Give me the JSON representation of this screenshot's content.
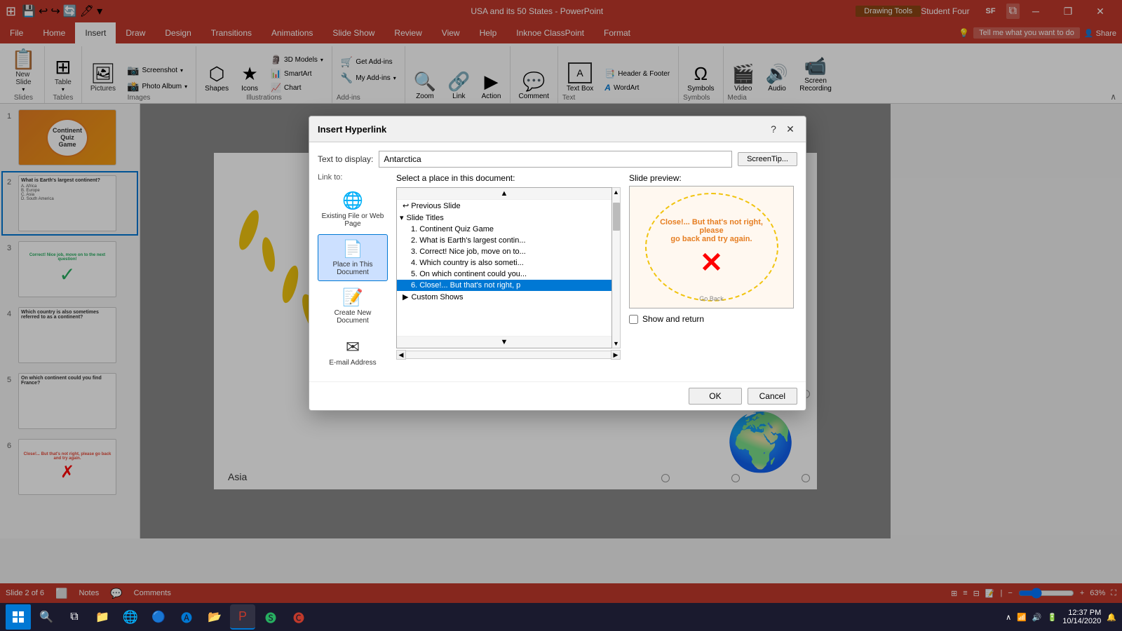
{
  "titlebar": {
    "title": "USA and its 50 States - PowerPoint",
    "drawing_tools": "Drawing Tools",
    "user_name": "Student Four",
    "user_initials": "SF",
    "minimize": "─",
    "restore": "❐",
    "close": "✕"
  },
  "ribbon": {
    "tabs": [
      "File",
      "Home",
      "Insert",
      "Draw",
      "Design",
      "Transitions",
      "Animations",
      "Slide Show",
      "Review",
      "View",
      "Help",
      "Inknoe ClassPoint",
      "Format"
    ],
    "active_tab": "Insert",
    "groups": {
      "slides": {
        "label": "Slides",
        "new_slide": "New Slide",
        "new_slide_icon": "📋"
      },
      "tables": {
        "label": "Tables",
        "table": "Table",
        "table_icon": "⊞"
      },
      "images": {
        "label": "Images",
        "pictures": "Pictures",
        "screenshot": "Screenshot",
        "photo_album": "Photo Album",
        "pictures_icon": "🖼"
      },
      "illustrations": {
        "label": "Illustrations",
        "shapes": "Shapes",
        "icons": "Icons",
        "models_3d": "3D Models",
        "smartart": "SmartArt",
        "chart": "Chart"
      },
      "addins": {
        "label": "Add-ins",
        "get_addins": "Get Add-ins",
        "my_addins": "My Add-ins"
      },
      "links": {
        "label": "",
        "zoom": "Zoom",
        "link": "Link",
        "action": "Action"
      },
      "comments": {
        "label": "",
        "comment": "Comment"
      },
      "text": {
        "label": "Text",
        "text_box": "Text Box",
        "header_footer": "Header & Footer",
        "wordart": "WordArt"
      },
      "symbols": {
        "label": "Symbols",
        "symbols": "Symbols"
      },
      "media": {
        "label": "Media",
        "video": "Video",
        "audio": "Audio",
        "screen_recording": "Screen Recording"
      }
    }
  },
  "slides": [
    {
      "number": "1",
      "title": "Continent Quiz Game",
      "color": "orange"
    },
    {
      "number": "2",
      "title": "What is Earth's largest continent?",
      "color": "white",
      "active": true
    },
    {
      "number": "3",
      "title": "Correct! Nice job, move on",
      "color": "white"
    },
    {
      "number": "4",
      "title": "Which country is also sometimes",
      "color": "white"
    },
    {
      "number": "5",
      "title": "On which continent could you find France?",
      "color": "white"
    },
    {
      "number": "6",
      "title": "Close!... But that's not right, please go back and try again.",
      "color": "white"
    }
  ],
  "canvas": {
    "slide_label": "Asia"
  },
  "statusbar": {
    "slide_info": "Slide 2 of 6",
    "notes": "Notes",
    "comments": "Comments",
    "zoom": "63%",
    "plus": "+"
  },
  "dialog": {
    "title": "Insert Hyperlink",
    "help_btn": "?",
    "close_btn": "✕",
    "link_to_label": "Link to:",
    "text_display_label": "Text to display:",
    "text_display_value": "Antarctica",
    "screentip_label": "ScreenTip...",
    "nav_items": [
      {
        "id": "existing",
        "label": "Existing File or Web Page",
        "icon": "🌐"
      },
      {
        "id": "place",
        "label": "Place in This Document",
        "icon": "📄",
        "active": true
      },
      {
        "id": "create",
        "label": "Create New Document",
        "icon": "📝"
      },
      {
        "id": "email",
        "label": "E-mail Address",
        "icon": "✉"
      }
    ],
    "center": {
      "label": "Select a place in this document:",
      "items": [
        {
          "text": "Previous Slide",
          "indent": 0,
          "type": "item"
        },
        {
          "text": "Slide Titles",
          "indent": 0,
          "type": "section"
        },
        {
          "text": "1. Continent Quiz Game",
          "indent": 1,
          "type": "item"
        },
        {
          "text": "2. What is Earth's largest contin...",
          "indent": 1,
          "type": "item"
        },
        {
          "text": "3. Correct! Nice job, move on to...",
          "indent": 1,
          "type": "item"
        },
        {
          "text": "4. Which country is also someti...",
          "indent": 1,
          "type": "item"
        },
        {
          "text": "5. On which continent could you...",
          "indent": 1,
          "type": "item"
        },
        {
          "text": "6. Close!... But that's not right, p",
          "indent": 1,
          "type": "item",
          "selected": true
        },
        {
          "text": "Custom Shows",
          "indent": 0,
          "type": "item"
        }
      ]
    },
    "preview": {
      "label": "Slide preview:",
      "message": "Close!... But that's not right, please go back and try again.",
      "go_back": "Go Back"
    },
    "show_return_label": "Show and return",
    "ok_label": "OK",
    "cancel_label": "Cancel"
  }
}
